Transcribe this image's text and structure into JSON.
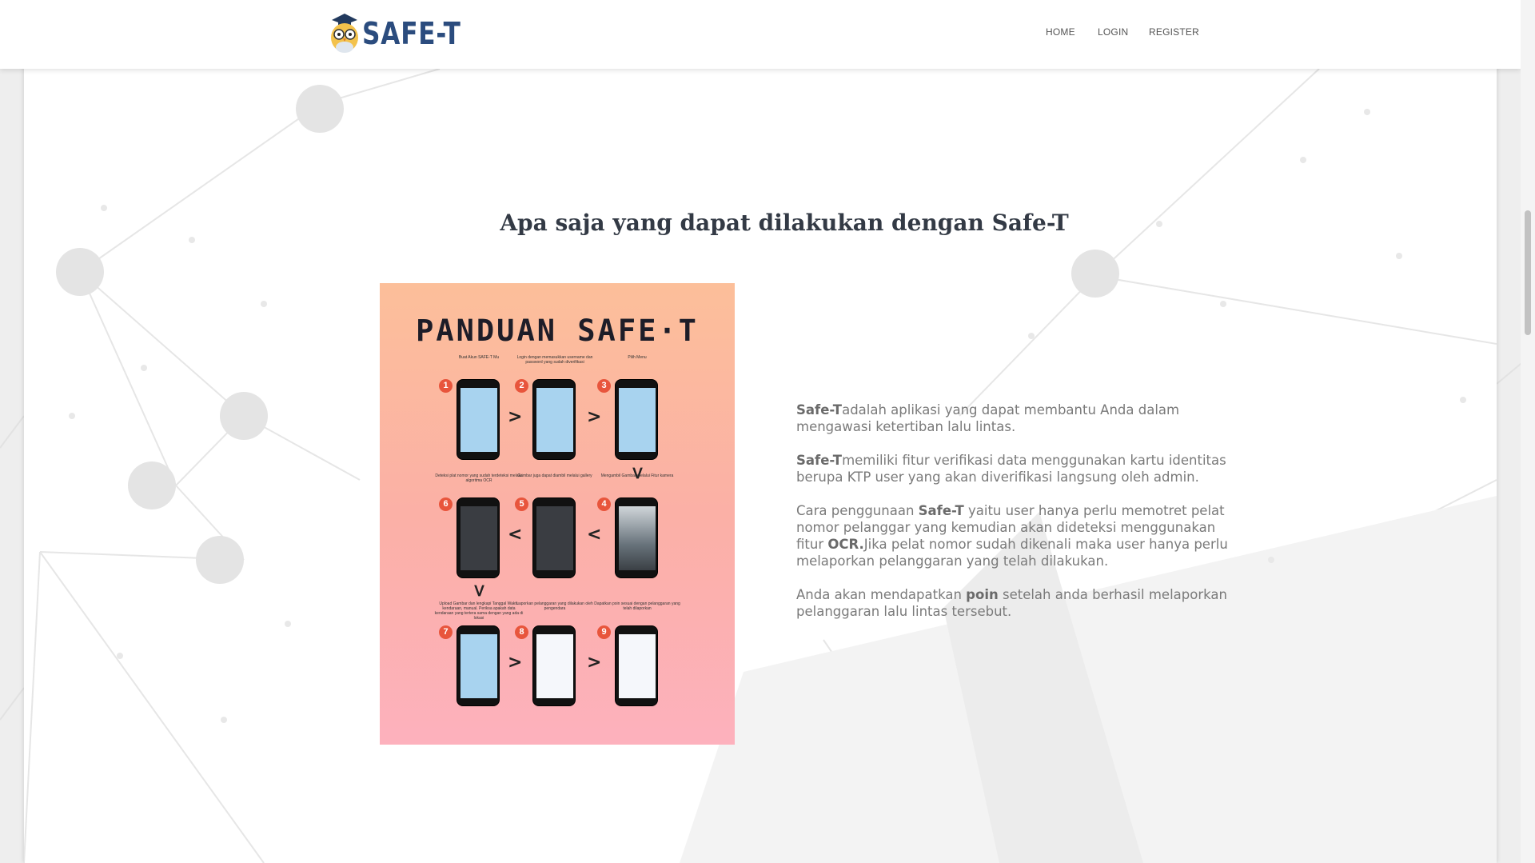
{
  "brand": {
    "name": "SAFE-T"
  },
  "nav": {
    "home": "HOME",
    "login": "LOGIN",
    "register": "REGISTER"
  },
  "section": {
    "title": "Apa saja yang dapat dilakukan dengan Safe-T"
  },
  "poster": {
    "title": "PANDUAN SAFE·T",
    "steps": [
      {
        "num": "1",
        "caption": "Buat Akun SAFE-T Mu"
      },
      {
        "num": "2",
        "caption": "Login dengan memasukkan username dan password yang sudah diverifikasi"
      },
      {
        "num": "3",
        "caption": "Pilih Menu"
      },
      {
        "num": "4",
        "caption": "Mengambil Gambar melalui Fitur kamera"
      },
      {
        "num": "5",
        "caption": "Gambar juga dapat diambil melalui gallery"
      },
      {
        "num": "6",
        "caption": "Deteksi plat nomor yang sudah terdeteksi melalui algoritma OCR"
      },
      {
        "num": "7",
        "caption": "Upload Gambar dan lengkapi Tanggal Waktu kendaraan, manual. Periksa apakah data kendaraan yang tertera sama dengan yang ada di lokasi"
      },
      {
        "num": "8",
        "caption": "Laporkan pelanggaran yang dilakukan oleh pengendara"
      },
      {
        "num": "9",
        "caption": "Dapatkan poin sesuai dengan pelanggaran yang telah dilaporkan"
      }
    ]
  },
  "description": {
    "p1_bold": "Safe-T",
    "p1_text": "adalah aplikasi yang dapat membantu Anda dalam mengawasi ketertiban lalu lintas.",
    "p2_bold": "Safe-T",
    "p2_text": "memiliki fitur verifikasi data menggunakan kartu identitas berupa KTP user yang akan diverifikasi langsung oleh admin.",
    "p3_text_a": "Cara penggunaan ",
    "p3_bold_a": "Safe-T",
    "p3_text_b": " yaitu user hanya perlu memotret pelat nomor pelanggar yang kemudian akan dideteksi menggunakan fitur ",
    "p3_bold_b": "OCR.",
    "p3_text_c": "Jika pelat nomor sudah dikenali maka user hanya perlu melaporkan pelanggaran yang telah dilakukan.",
    "p4_text_a": "Anda akan mendapatkan ",
    "p4_bold": "poin",
    "p4_text_b": " setelah anda berhasil melaporkan pelanggaran lalu lintas tersebut."
  },
  "colors": {
    "brand": "#2b4c7e",
    "badge": "#e8553c",
    "text": "#7a7a7a"
  }
}
